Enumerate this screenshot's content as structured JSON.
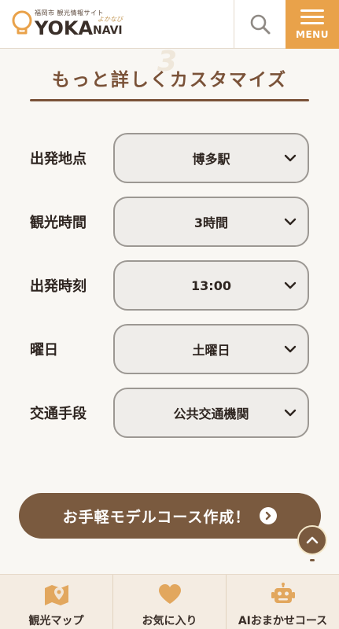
{
  "header": {
    "logo_subtitle": "福岡市 観光情報サイト",
    "logo_main": "YOKA",
    "logo_navi": "NAVI",
    "logo_yomi": "よかなび",
    "menu_label": "MENU",
    "icons": {
      "search": "search-icon",
      "menu": "hamburger-icon",
      "logo": "lightbulb-icon"
    }
  },
  "section": {
    "step_number": "3",
    "title": "もっと詳しくカスタマイズ"
  },
  "form": {
    "rows": [
      {
        "label": "出発地点",
        "value": "博多駅"
      },
      {
        "label": "観光時間",
        "value": "3時間"
      },
      {
        "label": "出発時刻",
        "value": "13:00"
      },
      {
        "label": "曜日",
        "value": "土曜日"
      },
      {
        "label": "交通手段",
        "value": "公共交通機関"
      }
    ]
  },
  "cta": {
    "label": "お手軽モデルコース作成！"
  },
  "bottom_nav": {
    "items": [
      {
        "label": "観光マップ",
        "icon": "map-pin-icon"
      },
      {
        "label": "お気に入り",
        "icon": "heart-icon"
      },
      {
        "label": "AIおまかせコース",
        "icon": "robot-icon"
      }
    ]
  },
  "colors": {
    "accent_orange": "#e9a24a",
    "brown": "#7a5a3f",
    "title_brown": "#7a5238",
    "nav_icon": "#e2a75e",
    "page_bg": "#f9f7f3"
  }
}
